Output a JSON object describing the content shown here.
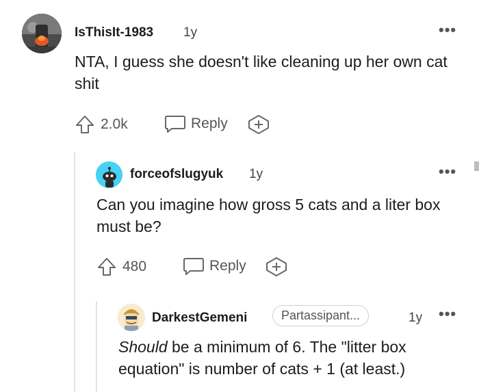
{
  "comments": [
    {
      "username": "IsThisIt-1983",
      "age": "1y",
      "text": "NTA, I guess she doesn't like cleaning up her own cat shit",
      "votes": "2.0k",
      "reply_label": "Reply"
    },
    {
      "username": "forceofslugyuk",
      "age": "1y",
      "text": "Can you imagine how gross 5 cats and a liter box must be?",
      "votes": "480",
      "reply_label": "Reply"
    },
    {
      "username": "DarkestGemeni",
      "flair": "Partassipant...",
      "age": "1y",
      "text_emphasis": "Should",
      "text_rest": " be a minimum of 6. The \"litter box equation\" is number of cats + 1 (at least.)"
    }
  ],
  "icons": {
    "more": "more-options-icon",
    "upvote": "upvote-arrow-icon",
    "reply": "speech-bubble-icon",
    "award": "award-plus-icon"
  },
  "colors": {
    "text": "#1c1c1c",
    "muted": "#555555",
    "thread_line": "#e3e3e3",
    "avatar2_bg": "#46d1f5"
  }
}
